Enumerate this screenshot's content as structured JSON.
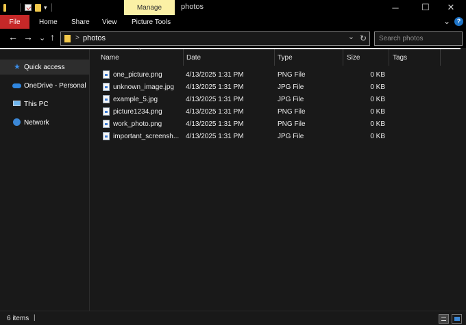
{
  "window": {
    "title": "photos",
    "manage_tab": "Manage",
    "minimize_glyph": "─",
    "maximize_glyph": "☐",
    "close_glyph": "✕"
  },
  "ribbon": {
    "file": "File",
    "tabs": [
      "Home",
      "Share",
      "View",
      "Picture Tools"
    ],
    "collapse_glyph": "⌄",
    "help_glyph": "?"
  },
  "nav": {
    "back_glyph": "←",
    "forward_glyph": "→",
    "recent_glyph": "⌄",
    "up_glyph": "↑"
  },
  "address": {
    "separator": ">",
    "folder": "photos",
    "dropdown_glyph": "⌄",
    "refresh_glyph": "↻"
  },
  "search": {
    "placeholder": "Search photos"
  },
  "sidebar": {
    "items": [
      {
        "label": "Quick access",
        "icon": "star-icon"
      },
      {
        "label": "OneDrive - Personal",
        "icon": "cloud-icon"
      },
      {
        "label": "This PC",
        "icon": "computer-icon"
      },
      {
        "label": "Network",
        "icon": "network-icon"
      }
    ]
  },
  "columns": {
    "name": "Name",
    "date": "Date",
    "type": "Type",
    "size": "Size",
    "tags": "Tags",
    "sort_glyph": "^"
  },
  "files": [
    {
      "name": "one_picture.png",
      "date": "4/13/2025 1:31 PM",
      "type": "PNG File",
      "size": "0 KB"
    },
    {
      "name": "unknown_image.jpg",
      "date": "4/13/2025 1:31 PM",
      "type": "JPG File",
      "size": "0 KB"
    },
    {
      "name": "example_5.jpg",
      "date": "4/13/2025 1:31 PM",
      "type": "JPG File",
      "size": "0 KB"
    },
    {
      "name": "picture1234.png",
      "date": "4/13/2025 1:31 PM",
      "type": "PNG File",
      "size": "0 KB"
    },
    {
      "name": "work_photo.png",
      "date": "4/13/2025 1:31 PM",
      "type": "PNG File",
      "size": "0 KB"
    },
    {
      "name": "important_screensh...",
      "date": "4/13/2025 1:31 PM",
      "type": "JPG File",
      "size": "0 KB"
    }
  ],
  "status": {
    "item_count": "6 items",
    "separator": "|"
  },
  "colors": {
    "accent": "#c62828",
    "manage": "#fbf0a5",
    "background": "#191919",
    "help": "#1e74c8"
  }
}
